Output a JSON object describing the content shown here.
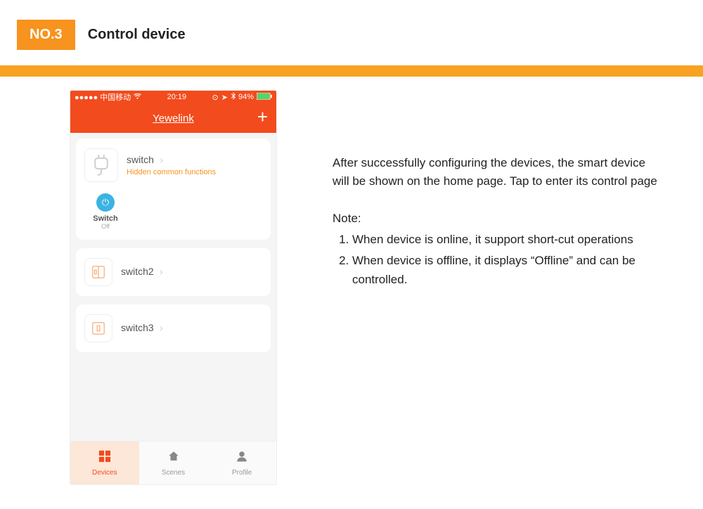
{
  "header": {
    "tag": "NO.3",
    "title": "Control device"
  },
  "phone": {
    "status": {
      "carrier": "●●●●● 中国移动",
      "time": "20:19",
      "battery": "94%"
    },
    "app_title": "Yewelink",
    "devices": [
      {
        "name": "switch",
        "sub": "Hidden common functions",
        "shortcut": {
          "label": "Switch",
          "state": "Off"
        }
      },
      {
        "name": "switch2"
      },
      {
        "name": "switch3"
      }
    ],
    "tabs": {
      "devices": "Devices",
      "scenes": "Scenes",
      "profile": "Profile"
    }
  },
  "text": {
    "paragraph": "After successfully configuring the devices, the smart device will be shown on the home page. Tap to enter its control page",
    "note_label": "Note:",
    "notes": [
      "When device is online, it support short-cut operations",
      "When device is offline, it displays “Offline” and can be controlled."
    ]
  }
}
